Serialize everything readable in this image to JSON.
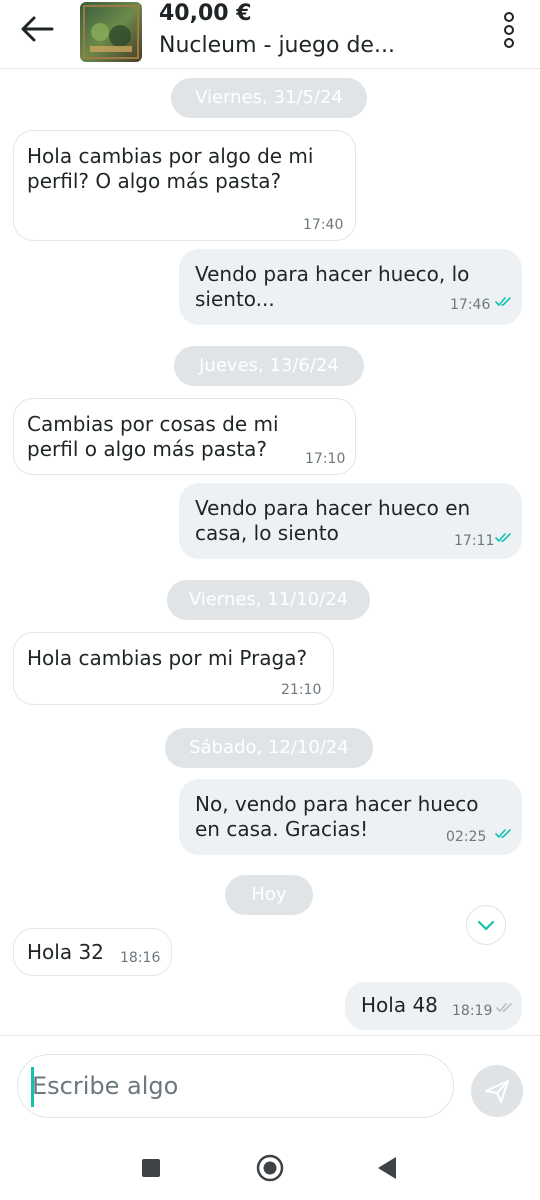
{
  "header": {
    "price": "40,00 €",
    "title": "Nucleum - juego de...",
    "thumb_text": "NUCLEUM"
  },
  "chat": {
    "messages": [
      {
        "type": "date",
        "text": "Viernes, 31/5/24"
      },
      {
        "type": "in",
        "lines": [
          "Hola cambias por algo de mi",
          "perfil? O algo más pasta?"
        ],
        "time": "17:40"
      },
      {
        "type": "out",
        "lines": [
          "Vendo para hacer hueco, lo",
          "siento..."
        ],
        "time": "17:46",
        "status": "read"
      },
      {
        "type": "date",
        "text": "Jueves, 13/6/24"
      },
      {
        "type": "in",
        "lines": [
          "Cambias por cosas de mi",
          "perfil o algo más pasta?"
        ],
        "time": "17:10"
      },
      {
        "type": "out",
        "lines": [
          "Vendo para hacer hueco en",
          "casa, lo siento"
        ],
        "time": "17:11",
        "status": "read"
      },
      {
        "type": "date",
        "text": "Viernes, 11/10/24"
      },
      {
        "type": "in",
        "lines": [
          "Hola cambias por mi Praga?"
        ],
        "time": "21:10"
      },
      {
        "type": "date",
        "text": "Sábado, 12/10/24"
      },
      {
        "type": "out",
        "lines": [
          "No, vendo para hacer hueco",
          "en casa. Gracias!"
        ],
        "time": "02:25",
        "status": "read"
      },
      {
        "type": "date",
        "text": "Hoy"
      },
      {
        "type": "in",
        "lines": [
          "Hola 32"
        ],
        "time": "18:16"
      },
      {
        "type": "out",
        "lines": [
          "Hola 48"
        ],
        "time": "18:19",
        "status": "delivered"
      }
    ]
  },
  "composer": {
    "placeholder": "Escribe algo"
  },
  "colors": {
    "accent": "#13c1ac",
    "read_tick": "#13c1ac",
    "delivered_tick": "#b7bfc4",
    "out_bubble": "#eef1f3",
    "date_pill": "#e0e4e7"
  },
  "icons": {
    "back": "arrow-left-icon",
    "menu": "more-vertical-icon",
    "scroll": "chevron-down-icon",
    "send": "send-icon",
    "nav_recents": "square-icon",
    "nav_home": "circle-icon",
    "nav_back": "triangle-back-icon"
  }
}
